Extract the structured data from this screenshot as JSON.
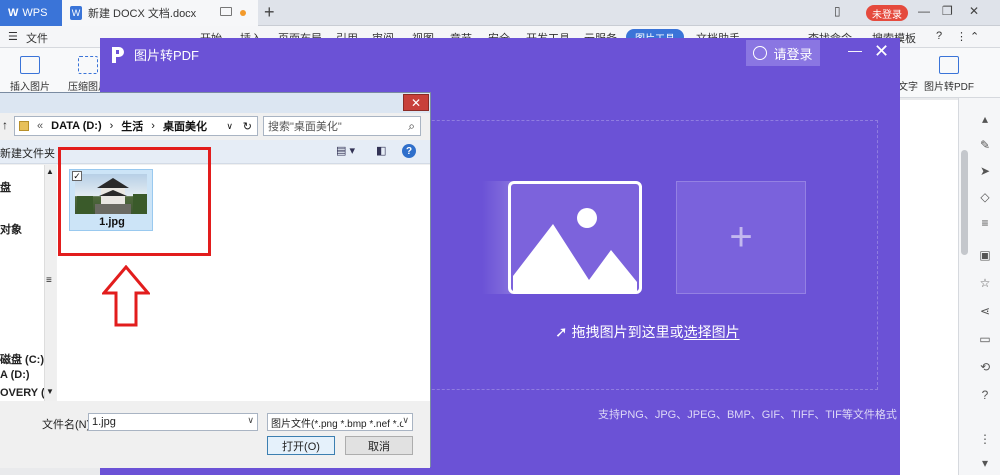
{
  "app": {
    "wps_tab": "WPS",
    "doc_tab": "新建 DOCX 文档.docx",
    "login_badge": "未登录"
  },
  "menubar": {
    "file": "文件",
    "items": [
      "开始",
      "插入",
      "页面布局",
      "引用",
      "审阅",
      "视图",
      "章节",
      "安全",
      "开发工具",
      "云服务"
    ],
    "active": "图片工具",
    "after": "文档助手",
    "search": "查找命令",
    "template": "搜索模板"
  },
  "toolbar": {
    "insert_image": "插入图片",
    "compress_image": "压缩图片",
    "to_text": "文字",
    "to_pdf": "图片转PDF"
  },
  "modal": {
    "title": "图片转PDF",
    "login": "请登录",
    "drag_hint": "拖拽图片到这里或",
    "select_link": "选择图片",
    "add_symbol": "+",
    "formats": "支持PNG、JPG、JPEG、BMP、GIF、TIFF、TIF等文件格式"
  },
  "dialog": {
    "path": [
      "DATA (D:)",
      "生活",
      "桌面美化"
    ],
    "search_placeholder": "搜索\"桌面美化\"",
    "new_folder": "新建文件夹",
    "nav_items": [
      "盘",
      "对象",
      "磁盘 (C:)",
      "A (D:)",
      "OVERY (E:"
    ],
    "file_name": "1.jpg",
    "filename_label": "文件名(N):",
    "filename_value": "1.jpg",
    "filter": "图片文件(*.png *.bmp *.nef *.c",
    "open": "打开(O)",
    "cancel": "取消"
  },
  "colors": {
    "modal_purple": "#6b52d6",
    "wps_blue": "#3a74d8",
    "highlight_red": "#e21d1d"
  }
}
